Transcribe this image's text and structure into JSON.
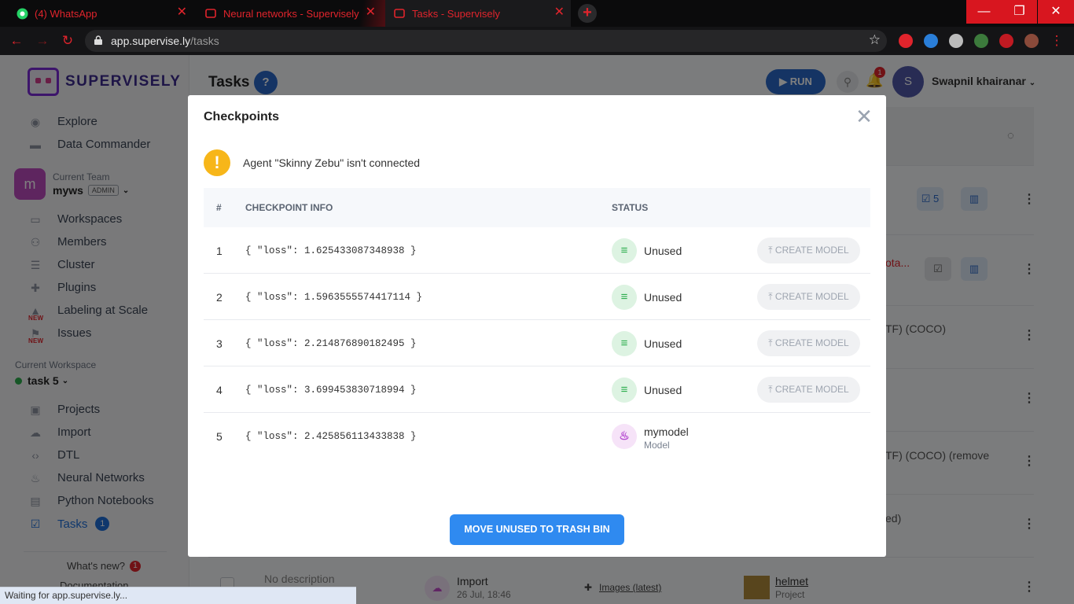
{
  "browser": {
    "tabs": [
      {
        "title": "(4) WhatsApp",
        "icon": "whatsapp-icon"
      },
      {
        "title": "Neural networks - Supervisely",
        "icon": "supervisely-icon"
      },
      {
        "title": "Tasks - Supervisely",
        "icon": "supervisely-icon"
      }
    ],
    "url_host": "app.supervise.ly",
    "url_path": "/tasks",
    "status": "Waiting for app.supervise.ly..."
  },
  "sidebar": {
    "logo": "SUPERVISELY",
    "top_items": [
      {
        "label": "Explore",
        "icon": "globe-icon"
      },
      {
        "label": "Data Commander",
        "icon": "folder-icon"
      }
    ],
    "team": {
      "label": "Current Team",
      "name": "myws",
      "role": "ADMIN",
      "avatar": "m"
    },
    "team_items": [
      {
        "label": "Workspaces",
        "icon": "monitor-icon"
      },
      {
        "label": "Members",
        "icon": "users-icon"
      },
      {
        "label": "Cluster",
        "icon": "cluster-icon"
      },
      {
        "label": "Plugins",
        "icon": "puzzle-icon"
      },
      {
        "label": "Labeling at Scale",
        "icon": "graduation-icon",
        "new": "NEW"
      },
      {
        "label": "Issues",
        "icon": "flag-icon",
        "new": "NEW"
      }
    ],
    "workspace": {
      "label": "Current Workspace",
      "name": "task 5"
    },
    "ws_items": [
      {
        "label": "Projects",
        "icon": "image-icon"
      },
      {
        "label": "Import",
        "icon": "cloud-upload-icon"
      },
      {
        "label": "DTL",
        "icon": "code-icon"
      },
      {
        "label": "Neural Networks",
        "icon": "flame-icon"
      },
      {
        "label": "Python Notebooks",
        "icon": "notebook-icon"
      },
      {
        "label": "Tasks",
        "icon": "checkbox-icon",
        "count": "1"
      }
    ],
    "whats_new": "What's new?",
    "whats_new_count": "1",
    "docs": "Documentation"
  },
  "main": {
    "title": "Tasks",
    "help": "?",
    "run": "RUN",
    "notifications": "1",
    "user_initial": "S",
    "user_name": "Swapnil khairanar",
    "bg": {
      "row1_count": "5",
      "row2_text": "ota...",
      "row3_text": "TF) (COCO)",
      "row5_text": "TF) (COCO) (remove",
      "row6_text": "ed)",
      "last_desc": "No description",
      "last_type": "Import",
      "last_date": "26 Jul, 18:46",
      "last_link": "Images (latest)",
      "last_project": "helmet",
      "last_project_sub": "Project"
    }
  },
  "modal": {
    "title": "Checkpoints",
    "warning": "Agent \"Skinny Zebu\" isn't connected",
    "columns": {
      "num": "#",
      "info": "CHECKPOINT INFO",
      "status": "STATUS"
    },
    "rows": [
      {
        "num": "1",
        "info": "{ \"loss\": 1.625433087348938 }",
        "status": "Unused",
        "action": "CREATE MODEL"
      },
      {
        "num": "2",
        "info": "{ \"loss\": 1.5963555574417114 }",
        "status": "Unused",
        "action": "CREATE MODEL"
      },
      {
        "num": "3",
        "info": "{ \"loss\": 2.214876890182495 }",
        "status": "Unused",
        "action": "CREATE MODEL"
      },
      {
        "num": "4",
        "info": "{ \"loss\": 3.699453830718994 }",
        "status": "Unused",
        "action": "CREATE MODEL"
      },
      {
        "num": "5",
        "info": "{ \"loss\": 2.425856113433838 }",
        "status": "mymodel",
        "status_sub": "Model"
      }
    ],
    "move_button": "MOVE UNUSED TO TRASH BIN"
  }
}
